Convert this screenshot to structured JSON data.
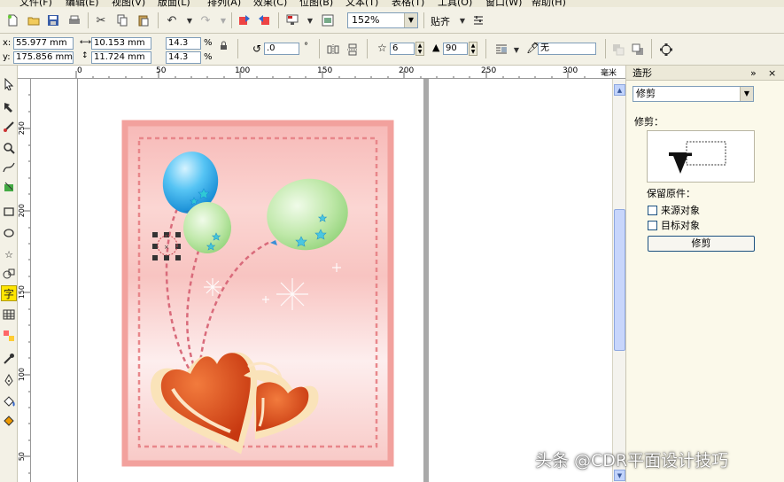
{
  "menu": [
    "文件(F)",
    "编辑(E)",
    "视图(V)",
    "版面(L)",
    "排列(A)",
    "效果(C)",
    "位图(B)",
    "文本(T)",
    "表格(T)",
    "工具(O)",
    "窗口(W)",
    "帮助(H)"
  ],
  "toolbar": {
    "zoom_value": "152%",
    "snap_label": "贴齐"
  },
  "property_bar": {
    "x_label": "x:",
    "x_value": "55.977 mm",
    "y_label": "y:",
    "y_value": "175.856 mm",
    "width_value": "10.153 mm",
    "height_value": "11.724 mm",
    "scale_w": "14.3",
    "scale_h": "14.3",
    "percent": "%",
    "rotation_value": ".0",
    "degree": "°",
    "star_points": "6",
    "star_sharpness": "90",
    "outline_value": "无"
  },
  "ruler": {
    "top_ticks": [
      "0",
      "50",
      "100",
      "150",
      "200",
      "250",
      "300"
    ],
    "unit": "毫米",
    "left_ticks": [
      "250",
      "200",
      "150",
      "100",
      "50"
    ]
  },
  "toolbox": {
    "active_tool_glyph": "字"
  },
  "docker": {
    "title": "造形",
    "collapse_glyph": "»",
    "close_glyph": "×",
    "mode_value": "修剪",
    "section_label": "修剪：",
    "keep_label": "保留原件：",
    "source_label": "来源对象",
    "target_label": "目标对象",
    "button_label": "修剪"
  },
  "watermark": "头条 @CDR平面设计技巧",
  "colors": {
    "card_pink": "#f4a9a6",
    "heart_red": "#d2451c",
    "balloon_blue": "#3ab2ef",
    "balloon_green": "#b6e6a2"
  }
}
